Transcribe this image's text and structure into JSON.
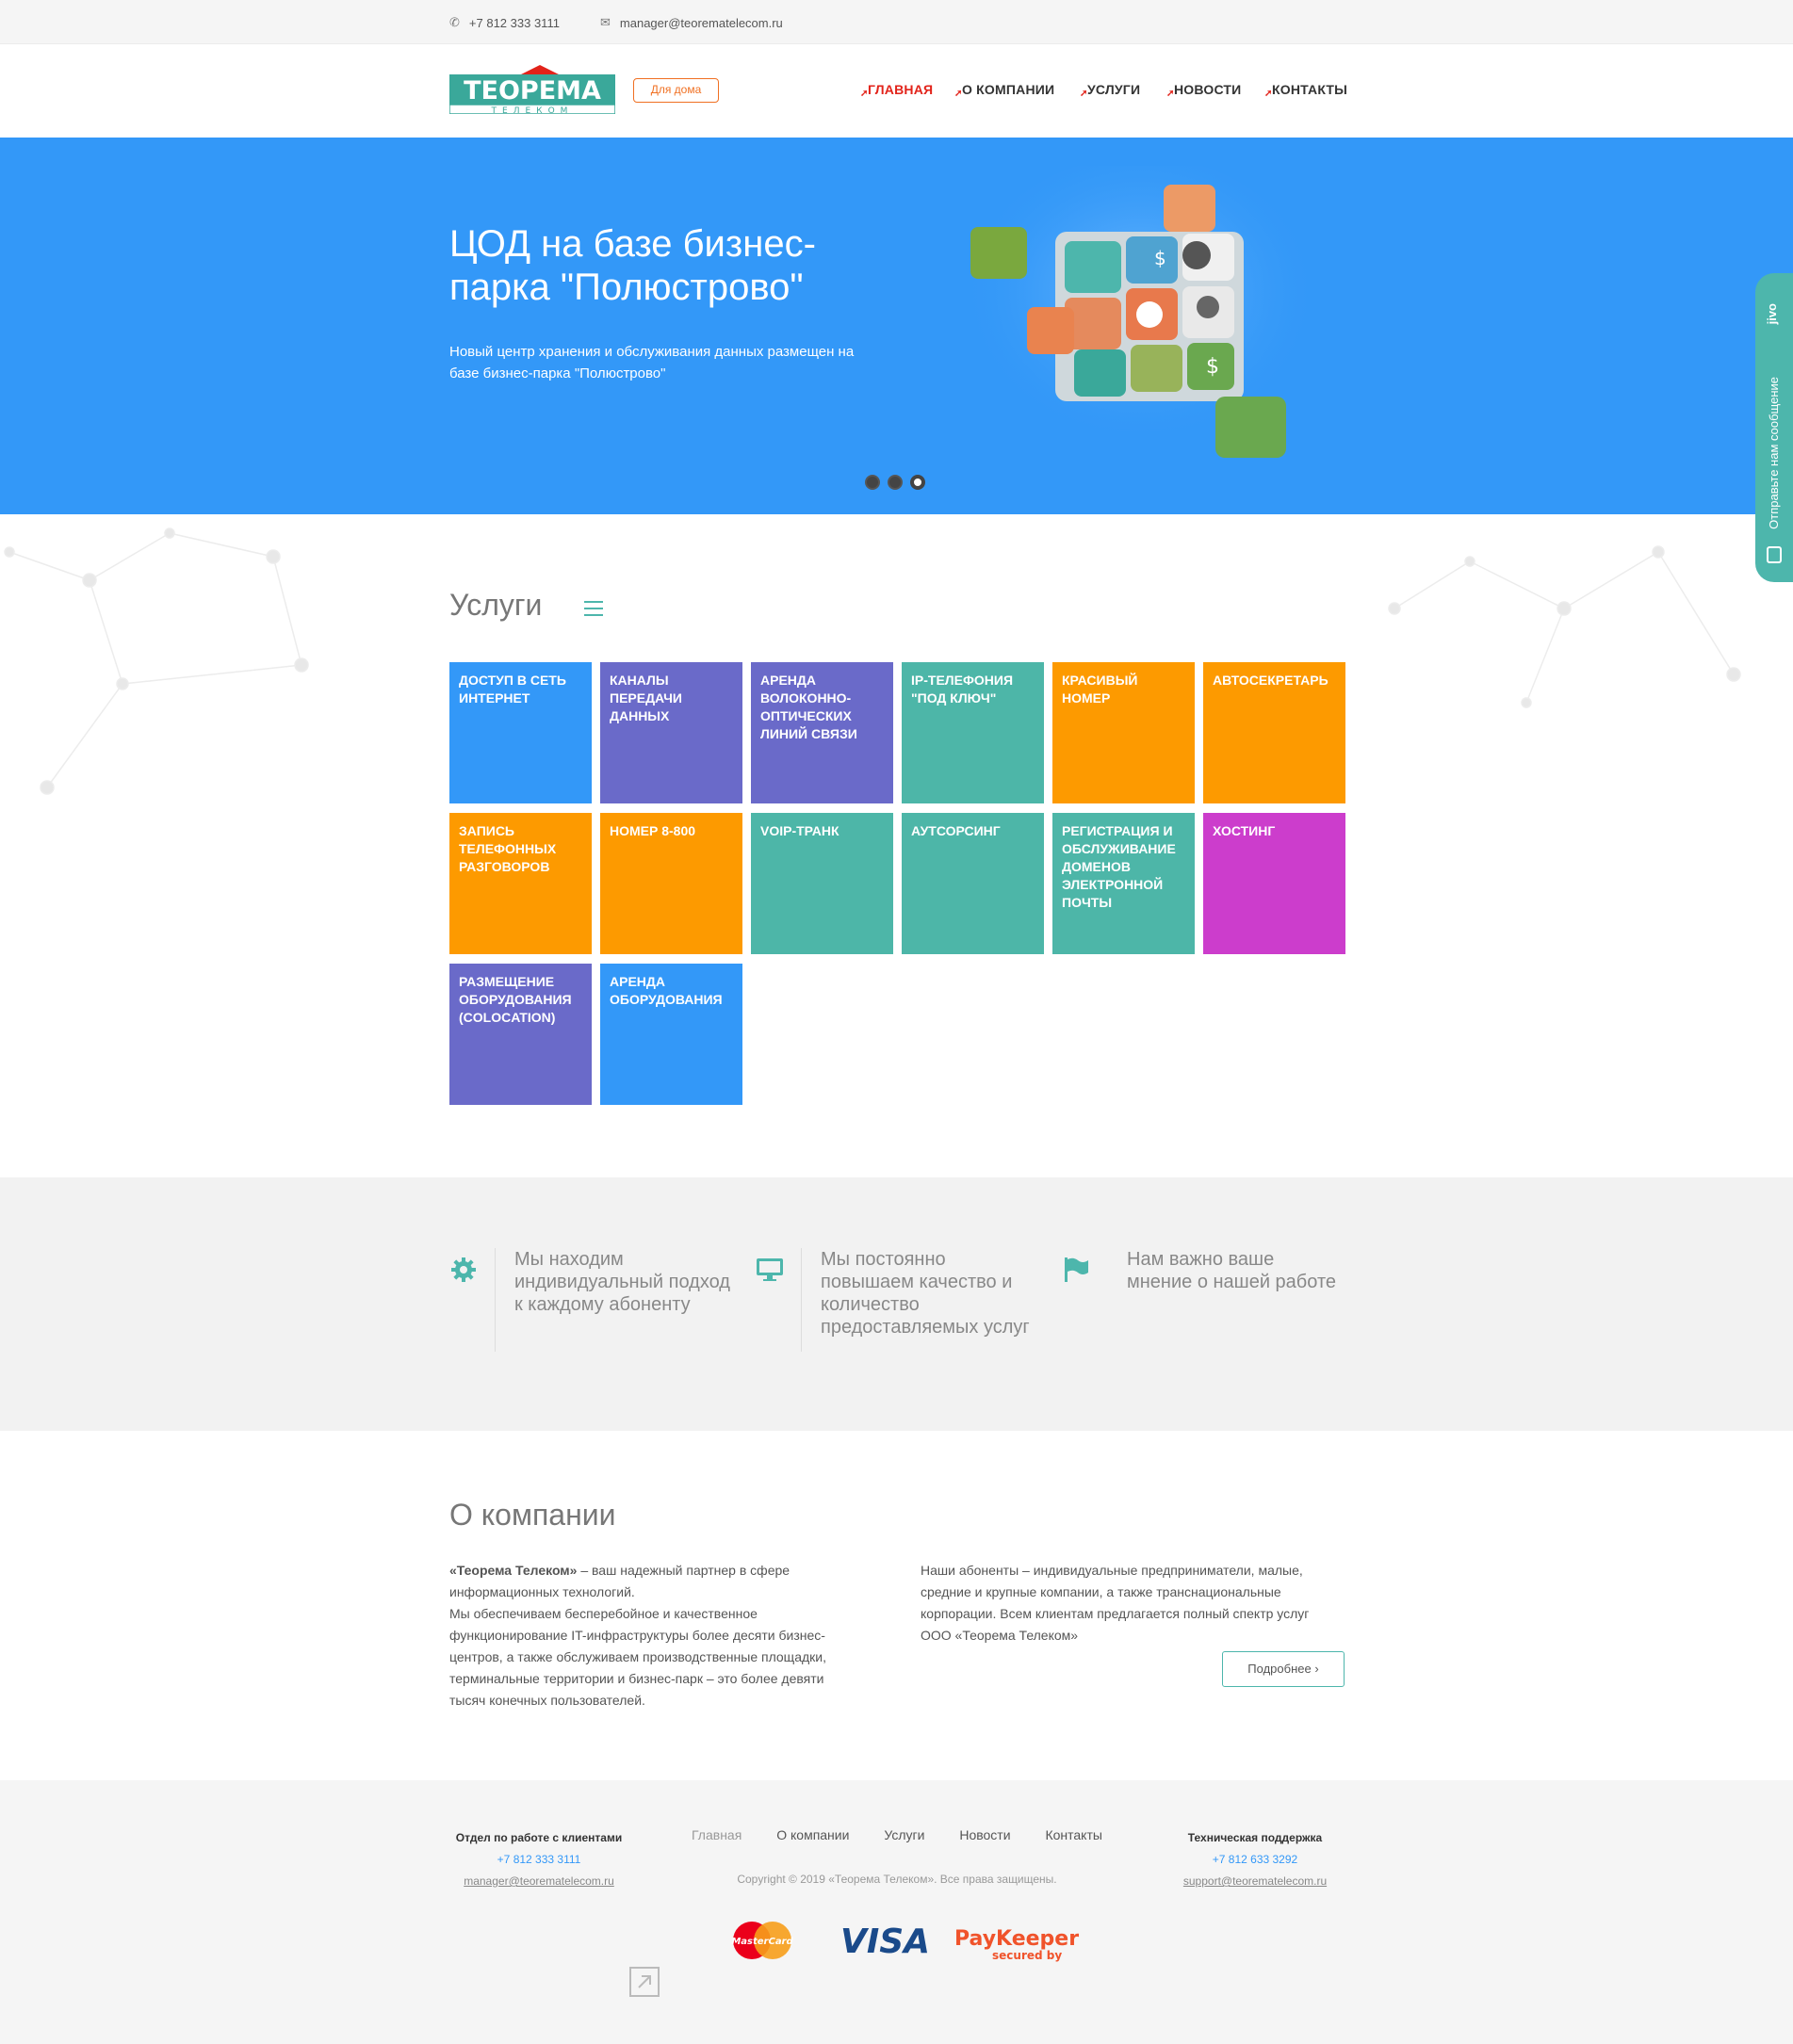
{
  "topbar": {
    "phone": "+7 812 333 3111",
    "email": "manager@teorematelecom.ru"
  },
  "header": {
    "logo_text": "ТЕОРЕМА",
    "logo_subtext": "ТЕЛЕКОМ",
    "home_button": "Для дома",
    "nav": [
      "ГЛАВНАЯ",
      "О КОМПАНИИ",
      "УСЛУГИ",
      "НОВОСТИ",
      "КОНТАКТЫ"
    ]
  },
  "hero": {
    "title": "ЦОД на базе бизнес-парка \"Полюстрово\"",
    "text": "Новый центр хранения и обслуживания данных размещен на базе бизнес-парка \"Полюстрово\"",
    "active_slide": 3,
    "slide_count": 3
  },
  "jivo": {
    "brand": "jivo",
    "label": "Отправьте нам сообщение"
  },
  "services": {
    "title": "Услуги",
    "tiles": [
      {
        "label": "Доступ в сеть интернет",
        "color": "#3398f8"
      },
      {
        "label": "Каналы передачи данных",
        "color": "#6a6ac9"
      },
      {
        "label": "Аренда волоконно-оптических линий связи",
        "color": "#6a6ac9"
      },
      {
        "label": "IP-телефония \"под ключ\"",
        "color": "#4db6a8"
      },
      {
        "label": "Красивый номер",
        "color": "#fd9a00"
      },
      {
        "label": "Автосекретарь",
        "color": "#fd9a00"
      },
      {
        "label": "Запись телефонных разговоров",
        "color": "#fd9a00"
      },
      {
        "label": "Номер 8-800",
        "color": "#fd9a00"
      },
      {
        "label": "VoIP-транк",
        "color": "#4db6a8"
      },
      {
        "label": "Аутсорсинг",
        "color": "#4db6a8"
      },
      {
        "label": "Регистрация и обслуживание доменов электронной почты",
        "color": "#4db6a8"
      },
      {
        "label": "Хостинг",
        "color": "#cc3dcc"
      },
      {
        "label": "Размещение оборудования (colocation)",
        "color": "#6a6ac9"
      },
      {
        "label": "Аренда оборудования",
        "color": "#3398f8"
      }
    ]
  },
  "features": [
    {
      "icon": "gear-icon",
      "text": "Мы находим индивидуальный подход к каждому абоненту"
    },
    {
      "icon": "monitor-icon",
      "text": "Мы постоянно повышаем качество и количество предоставляемых услуг"
    },
    {
      "icon": "flag-icon",
      "text": "Нам важно ваше мнение о нашей работе"
    }
  ],
  "about": {
    "title": "О компании",
    "company_name": "«Теорема Телеком»",
    "left_rest": " – ваш надежный партнер в сфере информационных технологий.",
    "left_p2": "Мы обеспечиваем бесперебойное и качественное функционирование IT-инфраструктуры более десяти бизнес-центров, а также обслуживаем производственные площадки, терминальные территории и бизнес-парк – это более девяти тысяч конечных пользователей.",
    "right": "Наши абоненты – индивидуальные предприниматели, малые, средние и крупные компании, а также транснациональные корпорации. Всем клиентам предлагается полный спектр услуг ООО «Теорема Телеком»",
    "more_button": "Подробнее"
  },
  "footer": {
    "clients": {
      "head": "Отдел по работе с клиентами",
      "phone": "+7 812 333 3111",
      "email": "manager@teorematelecom.ru"
    },
    "nav": [
      "Главная",
      "О компании",
      "Услуги",
      "Новости",
      "Контакты"
    ],
    "copyright": "Copyright © 2019 «Теорема Телеком». Все права защищены.",
    "support": {
      "head": "Техническая поддержка",
      "phone": "+7 812 633 3292",
      "email": "support@teorematelecom.ru"
    },
    "payments": {
      "mastercard": "MasterCard",
      "visa": "VISA",
      "paykeeper": "PayKeeper",
      "paykeeper_sub": "secured by"
    }
  }
}
